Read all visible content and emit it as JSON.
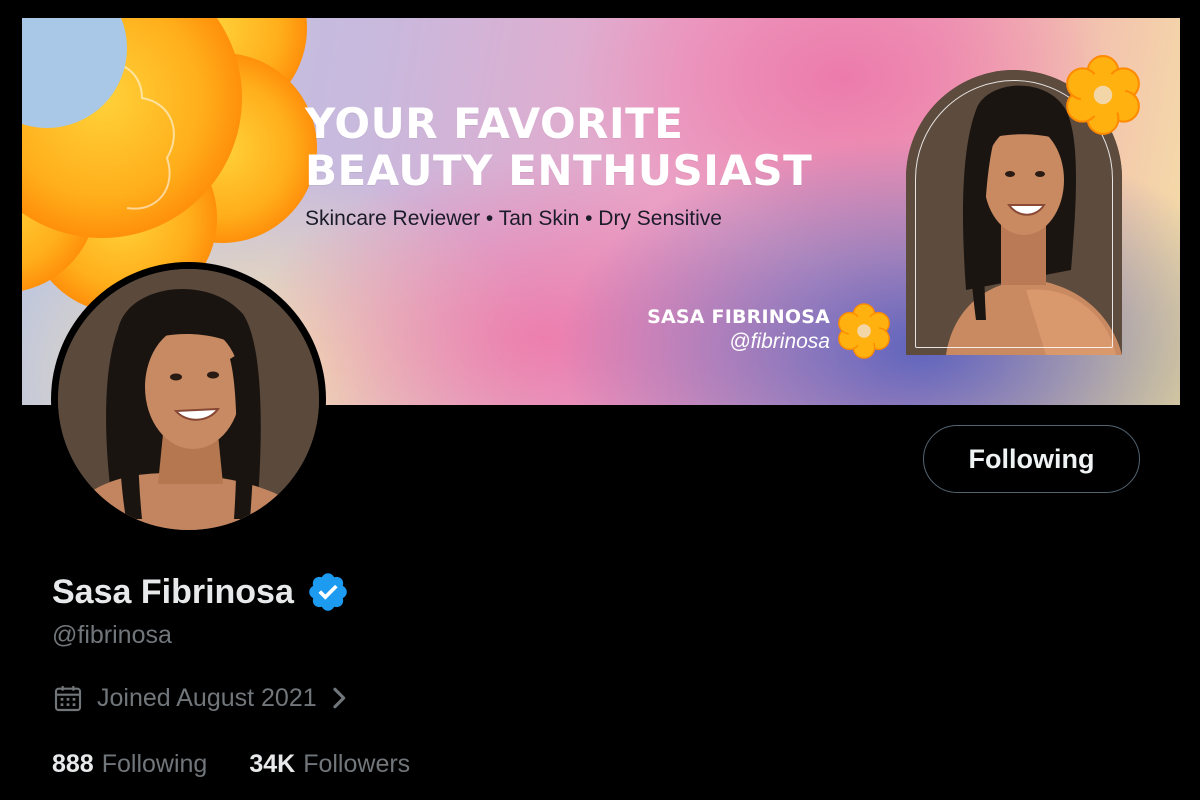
{
  "banner": {
    "title_line1": "YOUR FAVORITE",
    "title_line2": "BEAUTY ENTHUSIAST",
    "subtitle": "Skincare Reviewer • Tan Skin • Dry Sensitive",
    "name": "SASA FIBRINOSA",
    "handle": "@fibrinosa"
  },
  "profile": {
    "display_name": "Sasa Fibrinosa",
    "handle": "@fibrinosa",
    "verified": true,
    "joined": "Joined August 2021"
  },
  "actions": {
    "follow_button_label": "Following"
  },
  "stats": {
    "following_count": "888",
    "following_label": "Following",
    "followers_count": "34K",
    "followers_label": "Followers"
  },
  "icons": {
    "verified": "verified-badge-icon",
    "calendar": "calendar-icon",
    "chevron": "chevron-right-icon"
  },
  "colors": {
    "background": "#000000",
    "primary_text": "#e7e9ea",
    "secondary_text": "#71767b",
    "verified_blue": "#1d9bf0",
    "flower_orange": "#ff8a00",
    "flower_yellow": "#ffc21a",
    "button_border": "#536471"
  }
}
